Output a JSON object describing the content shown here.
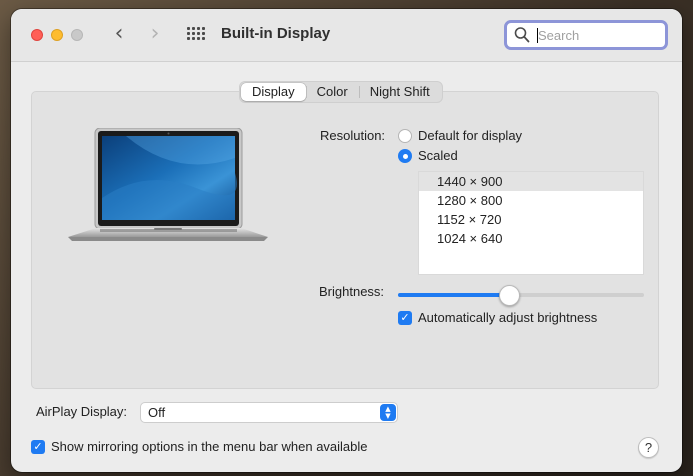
{
  "window": {
    "title": "Built-in Display",
    "back_glyph": "‹",
    "forward_glyph": "›"
  },
  "search": {
    "placeholder": "Search",
    "value": ""
  },
  "tabs": [
    {
      "label": "Display",
      "active": true
    },
    {
      "label": "Color",
      "active": false
    },
    {
      "label": "Night Shift",
      "active": false
    }
  ],
  "resolution": {
    "label": "Resolution:",
    "options": [
      {
        "label": "Default for display",
        "selected": false
      },
      {
        "label": "Scaled",
        "selected": true
      }
    ],
    "scaled_list": [
      {
        "label": "1440 × 900",
        "selected": true
      },
      {
        "label": "1280 × 800",
        "selected": false
      },
      {
        "label": "1152 × 720",
        "selected": false
      },
      {
        "label": "1024 × 640",
        "selected": false
      }
    ]
  },
  "brightness": {
    "label": "Brightness:",
    "level": 0.45,
    "auto_label": "Automatically adjust brightness",
    "auto_checked": true
  },
  "airplay": {
    "label": "AirPlay Display:",
    "value": "Off"
  },
  "mirroring": {
    "label": "Show mirroring options in the menu bar when available",
    "checked": true
  },
  "help": {
    "label": "?"
  },
  "colors": {
    "accent": "#1f7bf2",
    "close": "#ff5f57",
    "minimize": "#febc2e"
  }
}
